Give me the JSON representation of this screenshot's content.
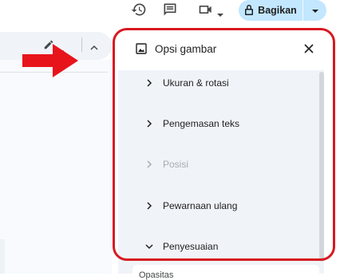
{
  "toolbar": {
    "icons": [
      "history-icon",
      "comment-icon",
      "video-call-icon",
      "dropdown-caret-icon"
    ],
    "share_label": "Bagikan"
  },
  "doc_toolbar": {
    "icons": [
      "pencil-edit-icon",
      "dropdown-caret-icon",
      "chevron-up-icon"
    ]
  },
  "panel": {
    "title": "Opsi gambar",
    "sections": [
      {
        "label": "Ukuran & rotasi",
        "state": "collapsed",
        "enabled": true
      },
      {
        "label": "Pengemasan teks",
        "state": "collapsed",
        "enabled": true
      },
      {
        "label": "Posisi",
        "state": "collapsed",
        "enabled": false
      },
      {
        "label": "Pewarnaan ulang",
        "state": "collapsed",
        "enabled": true
      },
      {
        "label": "Penyesuaian",
        "state": "expanded",
        "enabled": true
      }
    ],
    "sub_label_partial": "Opasitas"
  },
  "annotation": {
    "arrow_color": "#e8141b",
    "frame_color": "#d71920"
  },
  "colors": {
    "share_bg": "#c2e7ff",
    "panel_bg": "#f0f4f9"
  }
}
